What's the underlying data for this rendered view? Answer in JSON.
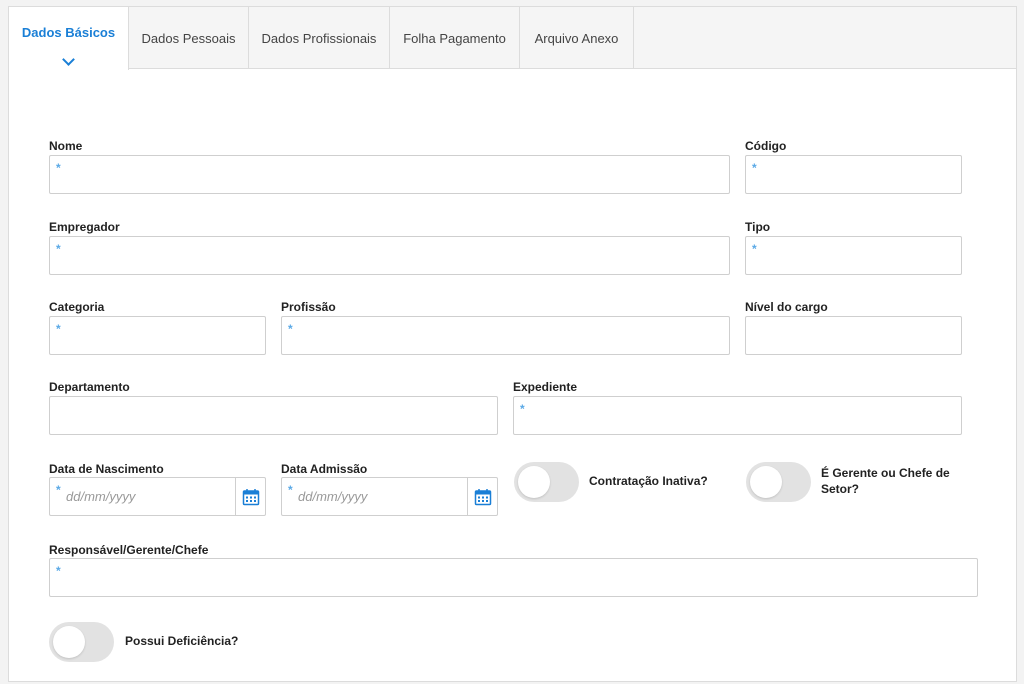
{
  "tabs": [
    {
      "label": "Dados Básicos",
      "active": true
    },
    {
      "label": "Dados Pessoais",
      "active": false
    },
    {
      "label": "Dados Profissionais",
      "active": false
    },
    {
      "label": "Folha Pagamento",
      "active": false
    },
    {
      "label": "Arquivo Anexo",
      "active": false
    }
  ],
  "form": {
    "nome": {
      "label": "Nome",
      "required": "*"
    },
    "codigo": {
      "label": "Código",
      "required": "*"
    },
    "empregador": {
      "label": "Empregador",
      "required": "*"
    },
    "tipo": {
      "label": "Tipo",
      "required": "*"
    },
    "categoria": {
      "label": "Categoria",
      "required": "*"
    },
    "profissao": {
      "label": "Profissão",
      "required": "*"
    },
    "nivel_cargo": {
      "label": "Nível do cargo"
    },
    "departamento": {
      "label": "Departamento"
    },
    "expediente": {
      "label": "Expediente",
      "required": "*"
    },
    "data_nascimento": {
      "label": "Data de Nascimento",
      "required": "*",
      "placeholder": "dd/mm/yyyy"
    },
    "data_admissao": {
      "label": "Data Admissão",
      "required": "*",
      "placeholder": "dd/mm/yyyy"
    },
    "contratacao_inativa": {
      "label": "Contratação Inativa?",
      "on": false
    },
    "gerente_chefe": {
      "label_line1": "É Gerente ou Chefe de",
      "label_line2": "Setor?",
      "on": false
    },
    "responsavel": {
      "label": "Responsável/Gerente/Chefe",
      "required": "*"
    },
    "possui_deficiencia": {
      "label": "Possui Deficiência?",
      "on": false
    }
  },
  "colors": {
    "accent": "#1a7fd6",
    "required_star": "#5aa9e6",
    "toggle_off": "#e2e2e2"
  }
}
